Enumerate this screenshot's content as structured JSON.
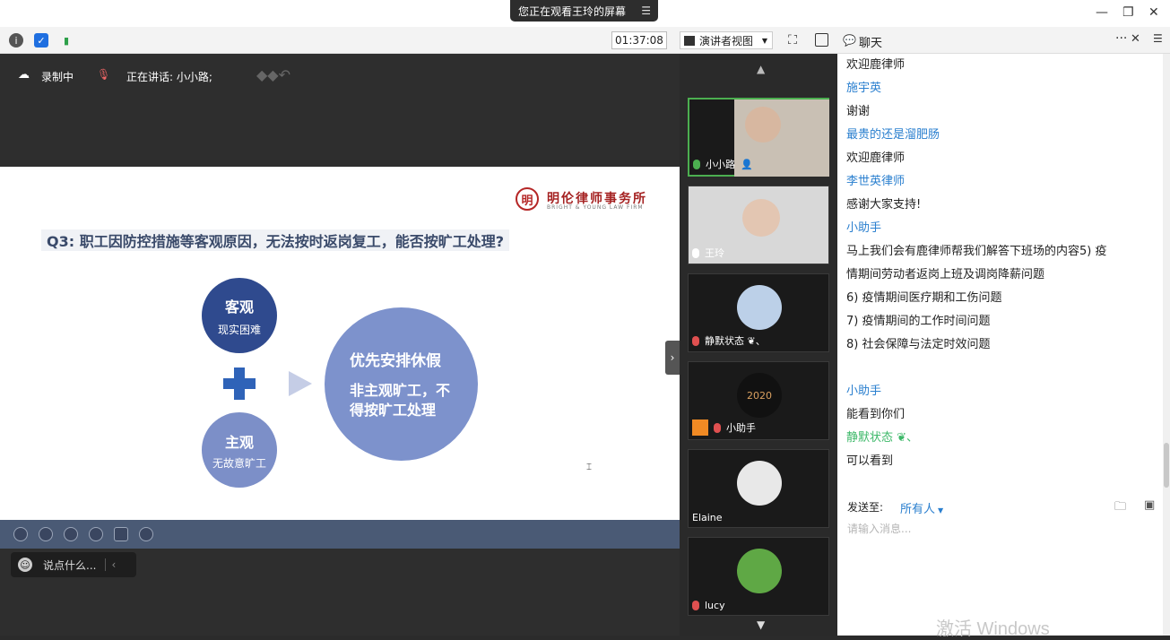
{
  "banner": {
    "text": "您正在观看王玲的屏幕",
    "menu_icon": "list-icon"
  },
  "toolbar": {
    "timer": "01:37:08",
    "view_mode": "演讲者视图"
  },
  "recording": {
    "status": "录制中",
    "speaking": "正在讲话: 小小路;"
  },
  "slide": {
    "logo_cn": "明伦律师事务所",
    "logo_en": "BRIGHT & YOUNG LAW FIRM",
    "question": "Q3: 职工因防控措施等客观原因，无法按时返岗复工，能否按旷工处理?",
    "objective": {
      "title": "客观",
      "sub": "现实困难"
    },
    "subjective": {
      "title": "主观",
      "sub": "无故意旷工"
    },
    "result": {
      "title": "优先安排休假",
      "body": "非主观旷工，不得按旷工处理"
    }
  },
  "chat_input": {
    "placeholder": "说点什么..."
  },
  "participants": [
    {
      "name": "小小路",
      "active": true
    },
    {
      "name": "王玲",
      "active": false
    },
    {
      "name": "静默状态 ❦、",
      "active": false
    },
    {
      "name": "小助手",
      "active": false,
      "avatar_text": "2020"
    },
    {
      "name": "Elaine",
      "active": false
    },
    {
      "name": "lucy",
      "active": false
    }
  ],
  "chat": {
    "title": "聊天",
    "messages": [
      {
        "text": "欢迎鹿律师",
        "kind": "text"
      },
      {
        "text": "施宇英",
        "kind": "sender"
      },
      {
        "text": "谢谢",
        "kind": "text"
      },
      {
        "text": "最贵的还是溜肥肠",
        "kind": "sender"
      },
      {
        "text": "欢迎鹿律师",
        "kind": "text"
      },
      {
        "text": "李世英律师",
        "kind": "sender"
      },
      {
        "text": "感谢大家支持!",
        "kind": "text"
      },
      {
        "text": "小助手",
        "kind": "sender"
      },
      {
        "text": "马上我们会有鹿律师帮我们解答下班场的内容5)      疫",
        "kind": "text"
      },
      {
        "text": "情期间劳动者返岗上班及调岗降薪问题",
        "kind": "text"
      },
      {
        "text": "6)        疫情期间医疗期和工伤问题",
        "kind": "text"
      },
      {
        "text": "7)        疫情期间的工作时间问题",
        "kind": "text"
      },
      {
        "text": "8)        社会保障与法定时效问题",
        "kind": "text"
      },
      {
        "text": "小助手",
        "kind": "sender"
      },
      {
        "text": "能看到你们",
        "kind": "text"
      },
      {
        "text": "静默状态 ❦、",
        "kind": "green"
      },
      {
        "text": "可以看到",
        "kind": "text"
      }
    ],
    "send_to_label": "发送至:",
    "send_to_value": "所有人",
    "input_placeholder": "请输入消息...",
    "watermark": "激活 Windows"
  }
}
